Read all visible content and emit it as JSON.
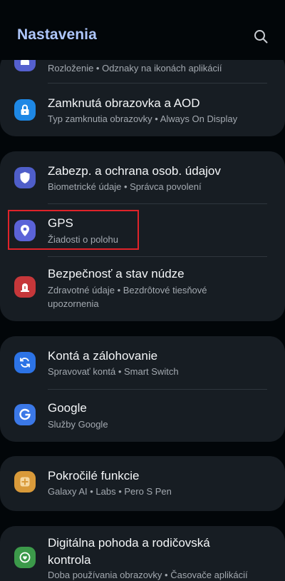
{
  "header": {
    "title": "Nastavenia",
    "search_icon": "search-icon"
  },
  "items": {
    "partial": {
      "subtitle": "Rozloženie • Odznaky na ikonách aplikácií",
      "icon": "home-icon"
    },
    "lock_screen": {
      "title": "Zamknutá obrazovka a AOD",
      "subtitle": "Typ zamknutia obrazovky • Always On Display",
      "icon": "lock-icon",
      "color": "#1e88e5"
    },
    "security": {
      "title": "Zabezp. a ochrana osob. údajov",
      "subtitle": "Biometrické údaje • Správca povolení",
      "icon": "shield-icon",
      "color": "#4f5ec9"
    },
    "gps": {
      "title": "GPS",
      "subtitle": "Žiadosti o polohu",
      "icon": "location-pin-icon",
      "color": "#5b63d8"
    },
    "safety": {
      "title": "Bezpečnosť a stav núdze",
      "subtitle": "Zdravotné údaje • Bezdrôtové tiesňové",
      "subtitle_line2": "upozornenia",
      "icon": "siren-icon",
      "color": "#c6373a"
    },
    "accounts": {
      "title": "Kontá a zálohovanie",
      "subtitle": "Spravovať kontá • Smart Switch",
      "icon": "sync-icon",
      "color": "#2c73e6"
    },
    "google": {
      "title": "Google",
      "subtitle": "Služby Google",
      "icon": "google-icon",
      "color": "#3b78e7"
    },
    "advanced": {
      "title": "Pokročilé funkcie",
      "subtitle": "Galaxy AI • Labs • Pero S Pen",
      "icon": "puzzle-plus-icon",
      "color": "#d99a3a"
    },
    "wellbeing": {
      "title": "Digitálna pohoda a rodičovská",
      "title_line2": "kontrola",
      "subtitle": "Doba používania obrazovky • Časovače aplikácií",
      "icon": "heart-circle-icon",
      "color": "#3c9a4a"
    }
  }
}
